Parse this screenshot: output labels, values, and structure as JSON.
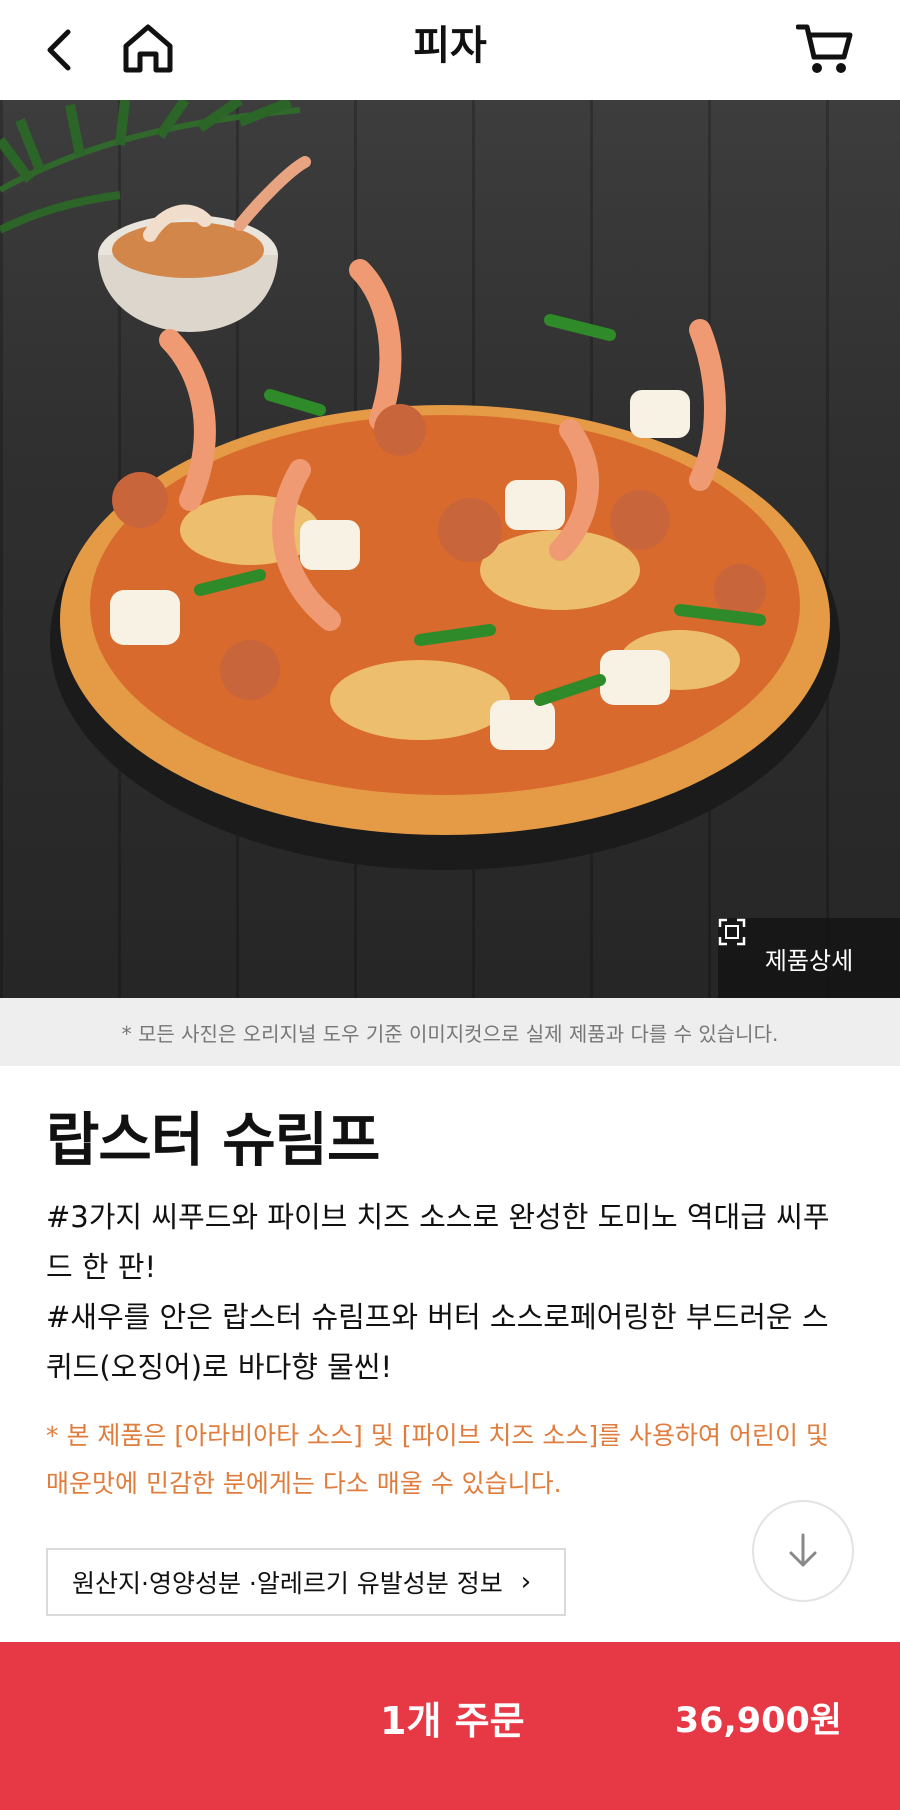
{
  "header": {
    "title": "피자"
  },
  "hero": {
    "detail_label": "제품상세"
  },
  "notice": "* 모든 사진은 오리지널 도우 기준 이미지컷으로 실제 제품과 다를 수 있습니다.",
  "product": {
    "name": "랍스터 슈림프",
    "desc_line1": "#3가지 씨푸드와 파이브 치즈 소스로 완성한 도미노 역대급 씨푸",
    "desc_line2": "드 한 판!",
    "desc_line3": "#새우를 안은 랍스터 슈림프와 버터 소스로페어링한 부드러운 스",
    "desc_line4": "퀴드(오징어)로 바다향 물씬!",
    "caution_line1": "* 본 제품은 [아라비아타 소스] 및 [파이브 치즈 소스]를 사용하여 어린이 및",
    "caution_line2": "매운맛에 민감한 분에게는 다소 매울 수 있습니다."
  },
  "info_button": "원산지·영양성분 ·알레르기 유발성분 정보",
  "order": {
    "label": "1개 주문",
    "price": "36,900원"
  },
  "colors": {
    "accent": "#e73845",
    "caution": "#e07d3c",
    "notice_bg": "#eeeeee"
  }
}
